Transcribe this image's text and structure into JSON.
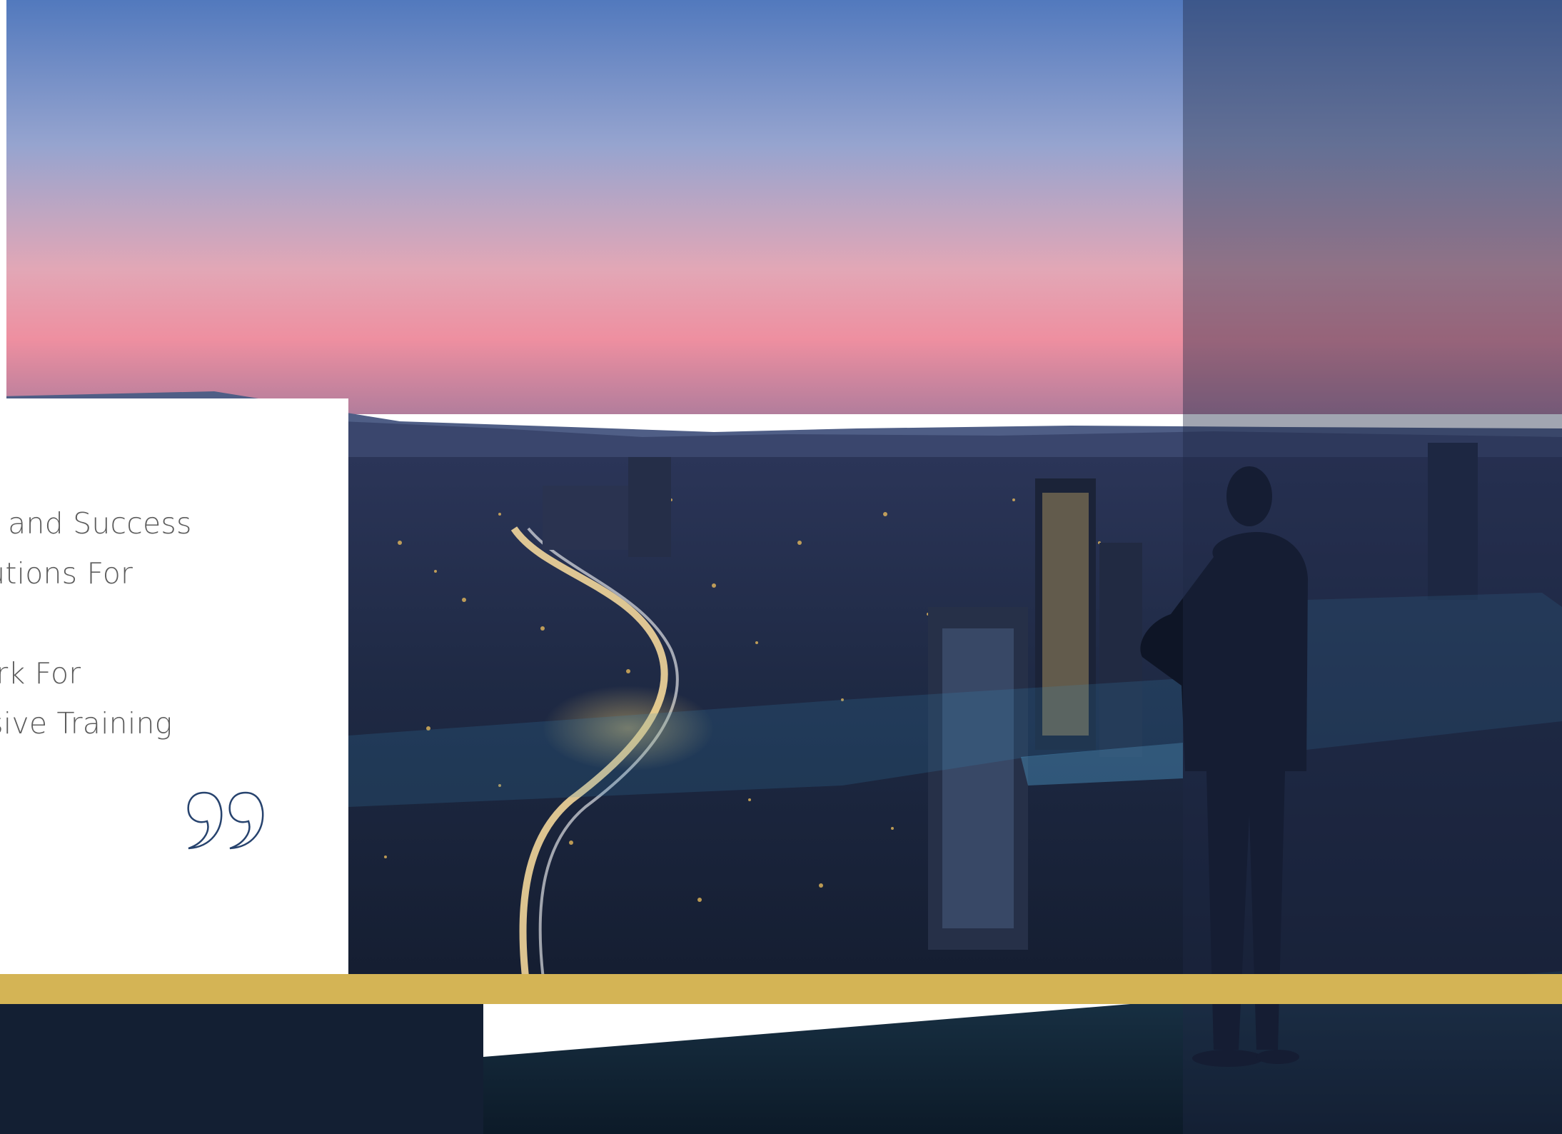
{
  "quote": {
    "lines": [
      "ation, and Success",
      "g Solutions For",
      "chmark For",
      "ehensive Training"
    ]
  },
  "colors": {
    "gold_band": "#d4b455",
    "navy_block": "#131f33",
    "quote_text": "#5d5d5d",
    "quote_mark": "#27436e"
  },
  "icons": {
    "quote_mark": "closing-quote-icon"
  },
  "background": "city-skyline-at-dusk"
}
